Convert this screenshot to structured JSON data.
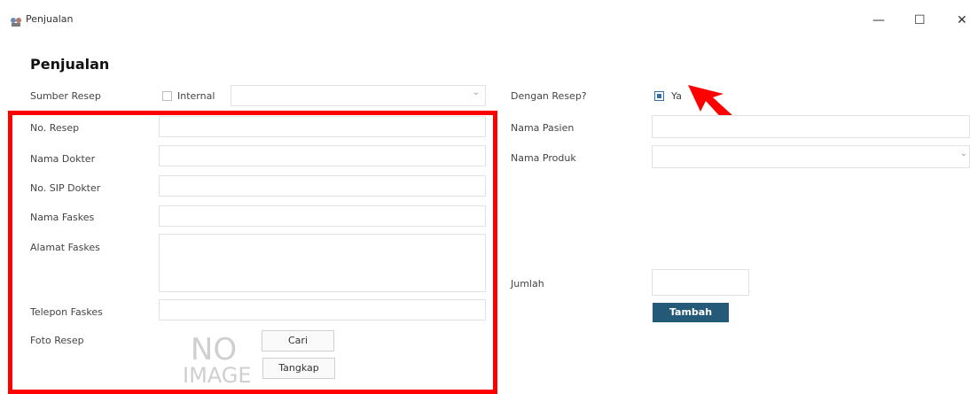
{
  "window": {
    "title": "Penjualan",
    "controls": {
      "minimize": "—",
      "maximize": "☐",
      "close": "✕"
    }
  },
  "page": {
    "heading": "Penjualan"
  },
  "left": {
    "sumber_resep": {
      "label": "Sumber Resep",
      "checkbox_label": "Internal",
      "select_value": "",
      "chevron": "⌄"
    },
    "no_resep": {
      "label": "No. Resep",
      "value": ""
    },
    "nama_dokter": {
      "label": "Nama Dokter",
      "value": ""
    },
    "no_sip": {
      "label": "No. SIP Dokter",
      "value": ""
    },
    "nama_faskes": {
      "label": "Nama Faskes",
      "value": ""
    },
    "alamat_faskes": {
      "label": "Alamat Faskes",
      "value": ""
    },
    "telepon_faskes": {
      "label": "Telepon Faskes",
      "value": ""
    },
    "foto_resep": {
      "label": "Foto Resep",
      "placeholder_line1": "NO",
      "placeholder_line2": "IMAGE",
      "cari_button": "Cari",
      "tangkap_button": "Tangkap"
    }
  },
  "right": {
    "dengan_resep": {
      "label": "Dengan Resep?",
      "checkbox_label": "Ya",
      "checked": true
    },
    "nama_pasien": {
      "label": "Nama Pasien",
      "value": ""
    },
    "nama_produk": {
      "label": "Nama Produk",
      "value": "",
      "chevron": "⌄"
    },
    "jumlah": {
      "label": "Jumlah",
      "value": ""
    },
    "tambah_button": "Tambah"
  },
  "colors": {
    "highlight": "#ff0000",
    "accent_button": "#245a78",
    "checkbox_fill": "#2f6fa6"
  }
}
